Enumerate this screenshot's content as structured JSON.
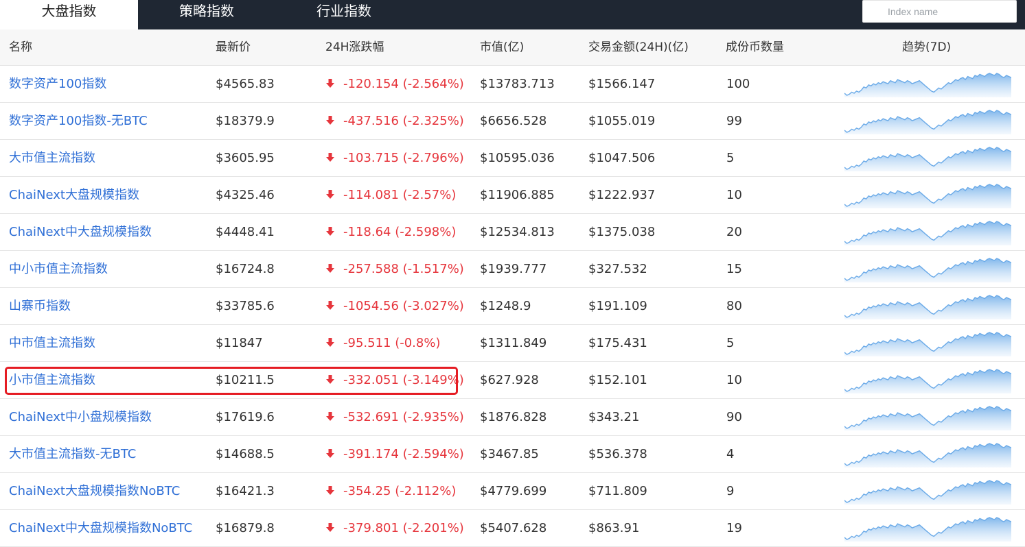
{
  "tabs": [
    {
      "label": "大盘指数",
      "active": true
    },
    {
      "label": "策略指数",
      "active": false
    },
    {
      "label": "行业指数",
      "active": false
    }
  ],
  "search": {
    "placeholder": "Index name"
  },
  "columns": {
    "name": "名称",
    "price": "最新价",
    "change": "24H涨跌幅",
    "market_cap": "市值(亿)",
    "volume": "交易金额(24H)(亿)",
    "constituents": "成份币数量",
    "trend": "趋势(7D)"
  },
  "colors": {
    "link": "#2f6fd6",
    "down": "#e6353c",
    "highlight": "#e51c23",
    "spark_line": "#6aaae8"
  },
  "rows": [
    {
      "name": "数字资产100指数",
      "price": "$4565.83",
      "change": "-120.154 (-2.564%)",
      "market_cap": "$13783.713",
      "volume": "$1566.147",
      "constituents": "100"
    },
    {
      "name": "数字资产100指数-无BTC",
      "price": "$18379.9",
      "change": "-437.516 (-2.325%)",
      "market_cap": "$6656.528",
      "volume": "$1055.019",
      "constituents": "99"
    },
    {
      "name": "大市值主流指数",
      "price": "$3605.95",
      "change": "-103.715 (-2.796%)",
      "market_cap": "$10595.036",
      "volume": "$1047.506",
      "constituents": "5"
    },
    {
      "name": "ChaiNext大盘规模指数",
      "price": "$4325.46",
      "change": "-114.081 (-2.57%)",
      "market_cap": "$11906.885",
      "volume": "$1222.937",
      "constituents": "10"
    },
    {
      "name": "ChaiNext中大盘规模指数",
      "price": "$4448.41",
      "change": "-118.64 (-2.598%)",
      "market_cap": "$12534.813",
      "volume": "$1375.038",
      "constituents": "20"
    },
    {
      "name": "中小市值主流指数",
      "price": "$16724.8",
      "change": "-257.588 (-1.517%)",
      "market_cap": "$1939.777",
      "volume": "$327.532",
      "constituents": "15"
    },
    {
      "name": "山寨币指数",
      "price": "$33785.6",
      "change": "-1054.56 (-3.027%)",
      "market_cap": "$1248.9",
      "volume": "$191.109",
      "constituents": "80"
    },
    {
      "name": "中市值主流指数",
      "price": "$11847",
      "change": "-95.511 (-0.8%)",
      "market_cap": "$1311.849",
      "volume": "$175.431",
      "constituents": "5"
    },
    {
      "name": "小市值主流指数",
      "price": "$10211.5",
      "change": "-332.051 (-3.149%)",
      "market_cap": "$627.928",
      "volume": "$152.101",
      "constituents": "10"
    },
    {
      "name": "ChaiNext中小盘规模指数",
      "price": "$17619.6",
      "change": "-532.691 (-2.935%)",
      "market_cap": "$1876.828",
      "volume": "$343.21",
      "constituents": "90"
    },
    {
      "name": "大市值主流指数-无BTC",
      "price": "$14688.5",
      "change": "-391.174 (-2.594%)",
      "market_cap": "$3467.85",
      "volume": "$536.378",
      "constituents": "4"
    },
    {
      "name": "ChaiNext大盘规模指数NoBTC",
      "price": "$16421.3",
      "change": "-354.25 (-2.112%)",
      "market_cap": "$4779.699",
      "volume": "$711.809",
      "constituents": "9"
    },
    {
      "name": "ChaiNext中大盘规模指数NoBTC",
      "price": "$16879.8",
      "change": "-379.801 (-2.201%)",
      "market_cap": "$5407.628",
      "volume": "$863.91",
      "constituents": "19"
    }
  ]
}
